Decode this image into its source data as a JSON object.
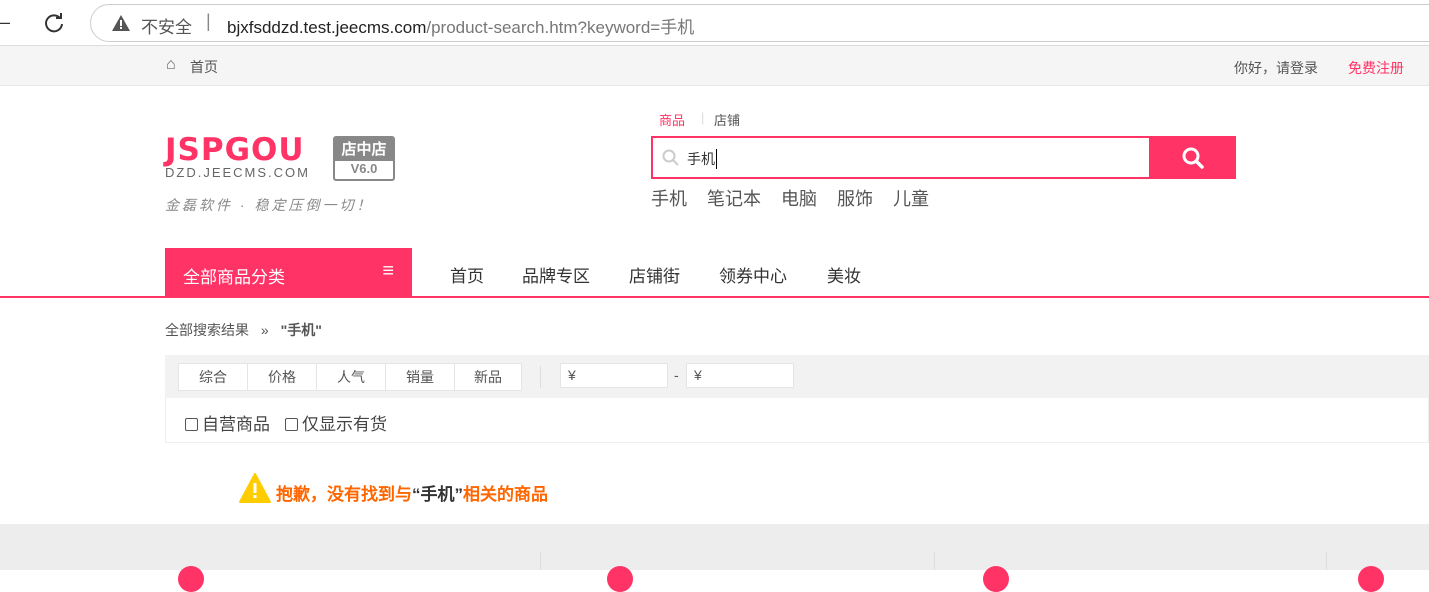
{
  "browser": {
    "security": "不安全",
    "url_host": "bjxfsddzd.test.jeecms.com",
    "url_path": "/product-search.htm?keyword=手机"
  },
  "topbar": {
    "home": "首页",
    "login": "你好，请登录",
    "register": "免费注册"
  },
  "logo": {
    "brand": "JSPGOU",
    "badge": "店中店",
    "version": "V6.0",
    "domain": "DZD.JEECMS.COM",
    "slogan": "金磊软件 · 稳定压倒一切！"
  },
  "search": {
    "tabs": [
      "商品",
      "店铺"
    ],
    "value": "手机",
    "hot": [
      "手机",
      "笔记本",
      "电脑",
      "服饰",
      "儿童"
    ]
  },
  "nav": {
    "category": "全部商品分类",
    "items": [
      "首页",
      "品牌专区",
      "店铺街",
      "领券中心",
      "美妆"
    ]
  },
  "breadcrumb": {
    "root": "全部搜索结果",
    "sep": "»",
    "keyword": "\"手机\""
  },
  "sort": {
    "items": [
      "综合",
      "价格",
      "人气",
      "销量",
      "新品"
    ],
    "price_symbol": "¥",
    "dash": "-"
  },
  "filters": [
    "自营商品",
    "仅显示有货"
  ],
  "empty": {
    "prefix": "抱歉，没有找到与",
    "keyword": "“手机”",
    "suffix": "相关的商品"
  },
  "colors": {
    "accent": "#ff3366",
    "warning": "#ff6600"
  }
}
